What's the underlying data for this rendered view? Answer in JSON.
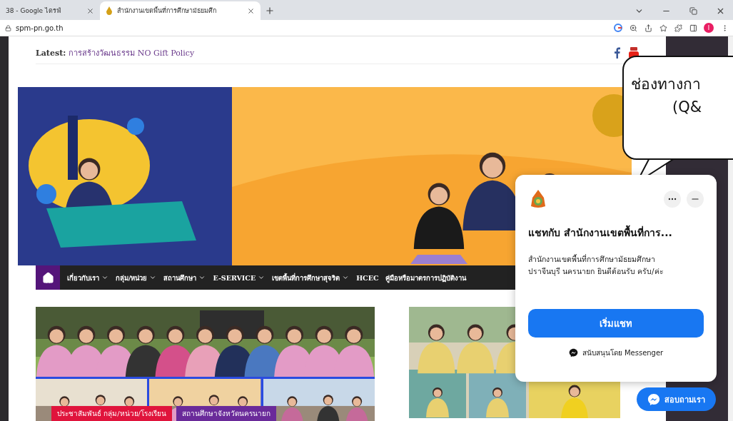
{
  "browser": {
    "tabs": [
      {
        "title": "38 - Google ไดรฟ์",
        "selected": false
      },
      {
        "title": "สำนักงานเขตพื้นที่การศึกษามัธยมศึก",
        "selected": true
      }
    ],
    "address": "spm-pn.go.th",
    "profile_initial": "I"
  },
  "site": {
    "latest_label": "Latest:",
    "latest_text": "การสร้างวัฒนธรรม NO Gift Policy",
    "nav": [
      {
        "label": "เกี่ยวกับเรา",
        "dropdown": true
      },
      {
        "label": "กลุ่ม/หน่วย",
        "dropdown": true
      },
      {
        "label": "สถานศึกษา",
        "dropdown": true
      },
      {
        "label": "E-SERVICE",
        "dropdown": true
      },
      {
        "label": "เขตพื้นที่การศึกษาสุจริต",
        "dropdown": true
      },
      {
        "label": "HCEC",
        "dropdown": false
      },
      {
        "label": "คู่มือหรือมาตรการปฏิบัติงาน",
        "dropdown": false
      }
    ],
    "news_tags": [
      {
        "label": "ประชาสัมพันธ์ กลุ่ม/หน่วย/โรงเรียน",
        "color": "#e0143c"
      },
      {
        "label": "สถานศึกษาจังหวัดนครนายก",
        "color": "#6a2a9a"
      }
    ]
  },
  "callout": {
    "lines": [
      "ช่องทางกา",
      "(Q&"
    ]
  },
  "chat": {
    "title": "แชทกับ สำนักงานเขตพื้นที่การ...",
    "message": "สำนักงานเขตพื้นที่การศึกษามัธยมศึกษา ปราจีนบุรี นครนายก ยินดีต้อนรับ ครับ/ค่ะ",
    "start_button": "เริ่มแชท",
    "footer": "สนับสนุนโดย Messenger"
  },
  "messenger_button": "สอบถามเรา"
}
